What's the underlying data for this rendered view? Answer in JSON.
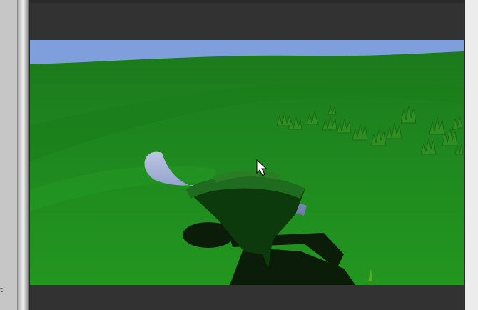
{
  "window": {
    "left_panel_label": "t"
  },
  "viewport": {
    "sky_color": "#7f9fdc",
    "ground_color": "#1e8a1e",
    "player_color": "#0c3a0c",
    "capsule_color": "#9ea6d8",
    "cursor": "arrow-cursor"
  }
}
